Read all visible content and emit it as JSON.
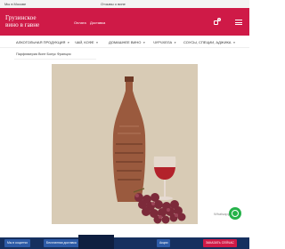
{
  "topbar": {
    "left_text": "Мы в Москве",
    "center_text": "Отзывы о вине"
  },
  "header": {
    "logo": "Грузинское вино в гавне",
    "links": [
      "Оплата",
      "Доставка",
      "Отзывы"
    ],
    "cart_count": "0"
  },
  "nav": {
    "items": [
      "АЛКОГОЛЬНАЯ ПРОДУКЦИЯ",
      "ЧАЙ, КОФЕ",
      "ДОМАШНЕЕ ВИНО",
      "ЧУРЧХЕЛА",
      "СОУСЫ, СПЕЦИИ, АДЖИКА"
    ]
  },
  "breadcrumb": "Парфюмерия Винт Бонус Франция",
  "chat": {
    "label": "Whatsapp"
  },
  "footer": {
    "buttons": [
      "Мы в соцсетях",
      "Бесплатная доставка",
      "Акции",
      "ЗАКАЗАТЬ СЕЙЧАС"
    ]
  },
  "colors": {
    "brand": "#cf1a47",
    "footer": "#16305f",
    "whatsapp": "#25b24a"
  }
}
